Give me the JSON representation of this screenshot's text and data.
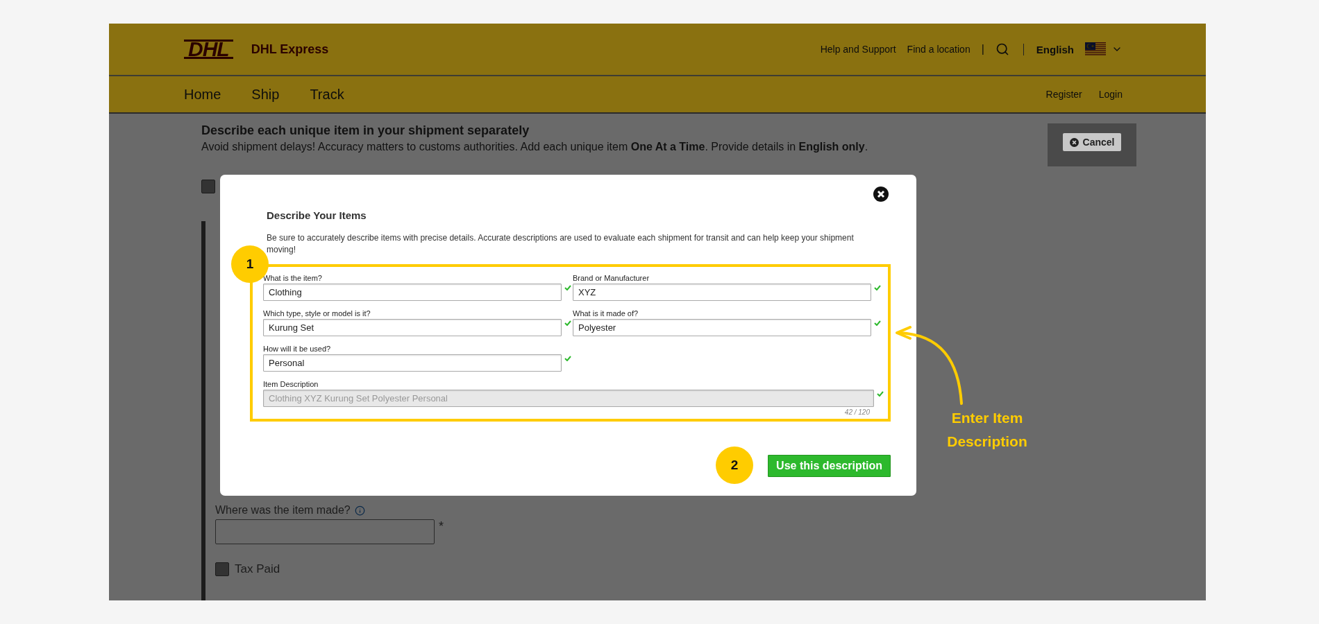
{
  "header": {
    "logo": "DHL",
    "brand": "DHL Express",
    "links": [
      "Help and Support",
      "Find a location"
    ],
    "separator": "|",
    "language": "English",
    "nav": [
      "Home",
      "Ship",
      "Track"
    ],
    "account": [
      "Register",
      "Login"
    ]
  },
  "page": {
    "title": "Describe each unique item in your shipment separately",
    "subtitle": "Avoid shipment delays! Accuracy matters to customs authorities.  Add each unique item **One At a Time**.  Provide details in **English only**.",
    "cancel": "Cancel",
    "top_checkbox": {
      "checked": false
    },
    "origin_label": "Where was the item made?",
    "required_mark": "*",
    "tax_paid": {
      "label": "Tax Paid",
      "checked": false
    }
  },
  "modal": {
    "title": "Describe Your Items",
    "intro": "Be sure to accurately describe items with precise details. Accurate descriptions are used to evaluate each shipment for transit and can help keep your shipment moving!",
    "fields": [
      {
        "label": "What is the item?",
        "value": "Clothing",
        "valid": true
      },
      {
        "label": "Brand or Manufacturer",
        "value": "XYZ",
        "valid": true
      },
      {
        "label": "Which type, style or model is it?",
        "value": "Kurung Set",
        "valid": true
      },
      {
        "label": "What is it made of?",
        "value": "Polyester",
        "valid": true
      },
      {
        "label": "How will it be used?",
        "value": "Personal",
        "valid": true
      }
    ],
    "description": {
      "label": "Item Description",
      "value": "Clothing XYZ Kurung Set Polyester Personal",
      "counter": "42 / 120",
      "disabled": true,
      "valid": true
    },
    "button": "Use this description"
  },
  "annotations": {
    "steps": [
      "1",
      "2"
    ],
    "callout": "Enter Item Description"
  }
}
